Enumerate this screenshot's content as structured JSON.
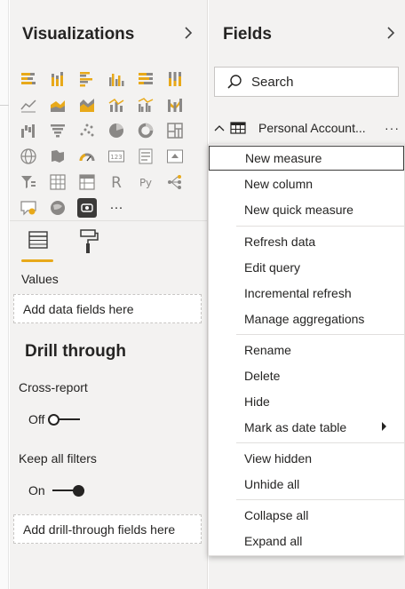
{
  "visualizations": {
    "title": "Visualizations",
    "tabs": {
      "fields_icon": "fields-tab-icon",
      "format_icon": "paint-roller-icon"
    },
    "values_label": "Values",
    "values_placeholder": "Add data fields here",
    "more_label": "···",
    "r_label": "R",
    "py_label": "Py"
  },
  "drill_through": {
    "title": "Drill through",
    "cross_report": {
      "label": "Cross-report",
      "state": "Off"
    },
    "keep_all_filters": {
      "label": "Keep all filters",
      "state": "On"
    },
    "drop_placeholder": "Add drill-through fields here"
  },
  "fields": {
    "title": "Fields",
    "search_placeholder": "Search",
    "table": {
      "name": "Personal Account...",
      "more": "···"
    }
  },
  "context_menu": {
    "items": [
      {
        "label": "New measure"
      },
      {
        "label": "New column"
      },
      {
        "label": "New quick measure"
      },
      {
        "label": "Refresh data"
      },
      {
        "label": "Edit query"
      },
      {
        "label": "Incremental refresh"
      },
      {
        "label": "Manage aggregations"
      },
      {
        "label": "Rename"
      },
      {
        "label": "Delete"
      },
      {
        "label": "Hide"
      },
      {
        "label": "Mark as date table"
      },
      {
        "label": "View hidden"
      },
      {
        "label": "Unhide all"
      },
      {
        "label": "Collapse all"
      },
      {
        "label": "Expand all"
      }
    ]
  },
  "colors": {
    "accent_yellow": "#e8a91a",
    "pane_bg": "#f3f2f1",
    "text": "#252423",
    "icon_gray": "#605e5c"
  }
}
